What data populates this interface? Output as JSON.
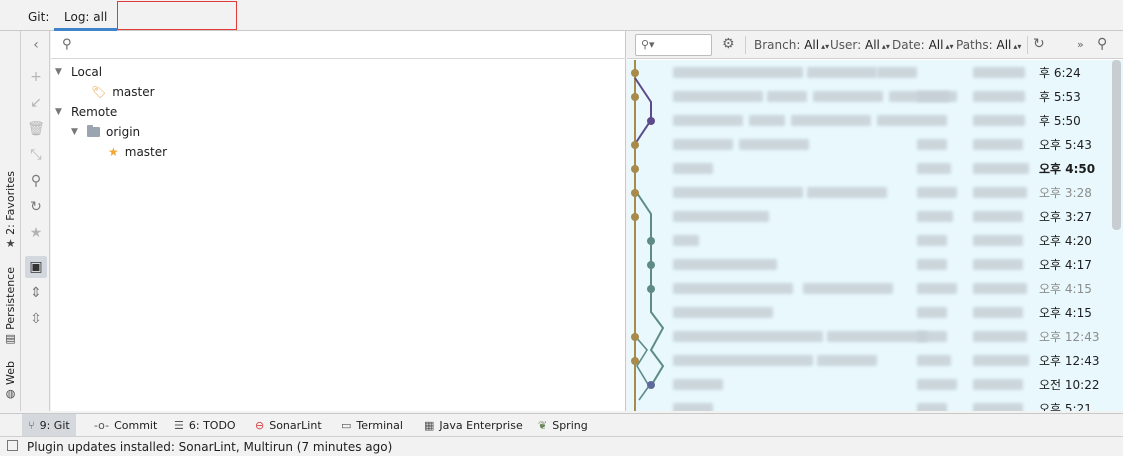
{
  "tabbar": {
    "git_label": "Git:",
    "active_tab": "Log: all"
  },
  "left_stripe": {
    "items": [
      {
        "label": "2: Favorites",
        "icon": "star-icon"
      },
      {
        "label": "Persistence",
        "icon": "persistence-icon"
      },
      {
        "label": "Web",
        "icon": "web-icon"
      }
    ]
  },
  "toolbar_icons": [
    "collapse-left-icon",
    "add-icon",
    "checkout-icon",
    "delete-icon",
    "compare-icon",
    "search-icon",
    "refresh-icon",
    "star-icon",
    "group-by-directory-icon",
    "expand-all-icon",
    "collapse-all-icon"
  ],
  "branches": {
    "local_label": "Local",
    "local_branches": [
      "master"
    ],
    "remote_label": "Remote",
    "remote_name": "origin",
    "remote_branches": [
      "master"
    ]
  },
  "log_toolbar": {
    "search_icon": "filter-search-icon",
    "branch": {
      "label": "Branch:",
      "value": "All"
    },
    "user": {
      "label": "User:",
      "value": "All"
    },
    "date": {
      "label": "Date:",
      "value": "All"
    },
    "paths": {
      "label": "Paths:",
      "value": "All"
    }
  },
  "log_rows": [
    {
      "time": "후 6:24",
      "style": "normal"
    },
    {
      "time": "후 5:53",
      "style": "normal"
    },
    {
      "time": "후 5:50",
      "style": "normal"
    },
    {
      "time": "오후 5:43",
      "style": "normal"
    },
    {
      "time": "오후 4:50",
      "style": "bold"
    },
    {
      "time": "오후 3:28",
      "style": "gray"
    },
    {
      "time": "오후 3:27",
      "style": "normal"
    },
    {
      "time": "오후 4:20",
      "style": "normal"
    },
    {
      "time": "오후 4:17",
      "style": "normal"
    },
    {
      "time": "오후 4:15",
      "style": "gray"
    },
    {
      "time": "오후 4:15",
      "style": "normal"
    },
    {
      "time": "오후 12:43",
      "style": "gray"
    },
    {
      "time": "오후 12:43",
      "style": "normal"
    },
    {
      "time": "오전 10:22",
      "style": "normal"
    },
    {
      "time": "오후 5:21",
      "style": "normal"
    }
  ],
  "bottom_tabs": [
    {
      "label": "9: Git",
      "icon": "git-icon",
      "active": true
    },
    {
      "label": "Commit",
      "icon": "commit-icon",
      "active": false
    },
    {
      "label": "6: TODO",
      "icon": "todo-icon",
      "active": false
    },
    {
      "label": "SonarLint",
      "icon": "sonarlint-icon",
      "active": false
    },
    {
      "label": "Terminal",
      "icon": "terminal-icon",
      "active": false
    },
    {
      "label": "Java Enterprise",
      "icon": "java-enterprise-icon",
      "active": false
    },
    {
      "label": "Spring",
      "icon": "spring-icon",
      "active": false
    }
  ],
  "status": {
    "message": "Plugin updates installed: SonarLint, Multirun (7 minutes ago)"
  }
}
